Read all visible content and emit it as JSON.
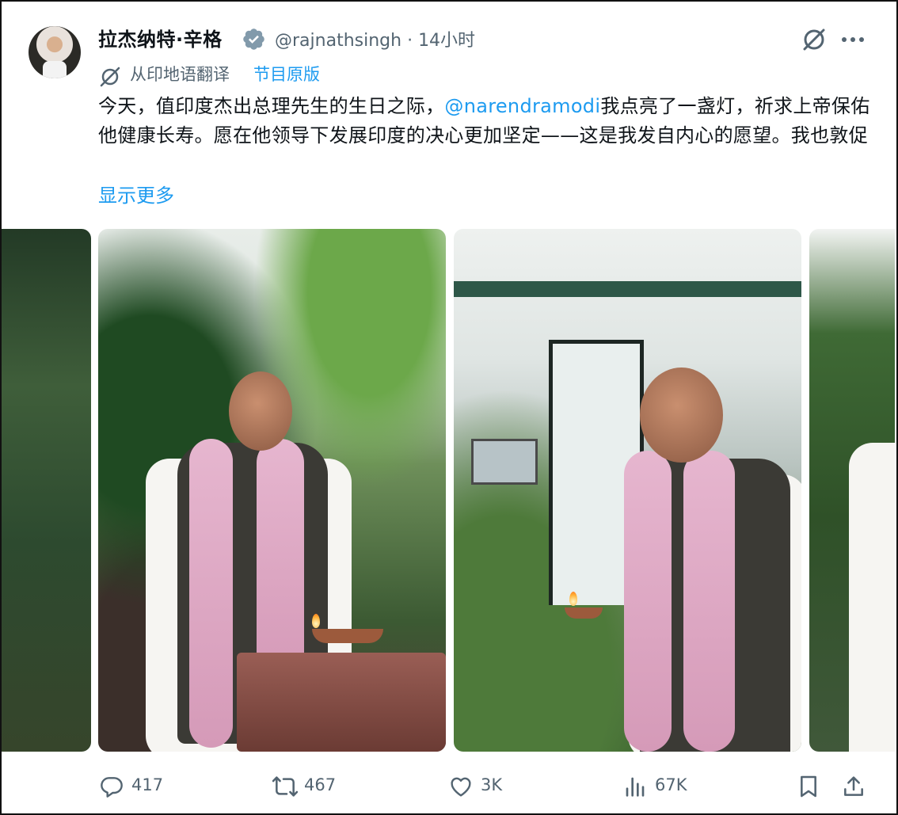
{
  "post": {
    "author_name": "拉杰纳特·辛格",
    "author_handle": "@rajnathsingh",
    "separator": "·",
    "time_ago": "14小时",
    "verified_icon": "verified-badge-icon",
    "translation_label": "从印地语翻译",
    "show_original_label": "节目原版",
    "text_part1": "今天，值印度杰出总理先生的生日之际，",
    "mention": "@narendramodi",
    "text_part2": "我点亮了一盏灯，祈求上帝保佑他健康长寿。愿在他领导下发展印度的决心更加坚定——这是我发自内心的愿望。我也敦促",
    "show_more_label": "显示更多"
  },
  "media": {
    "photos": [
      "photo-partial-left",
      "photo-lighting-diya-garden",
      "photo-holding-diya-veranda",
      "photo-partial-right"
    ]
  },
  "actions": {
    "replies": "417",
    "reposts": "467",
    "likes": "3K",
    "views": "67K"
  },
  "colors": {
    "text": "#0f1419",
    "secondary": "#536471",
    "accent": "#1d9bf0",
    "verified_badge": "#829aab"
  }
}
